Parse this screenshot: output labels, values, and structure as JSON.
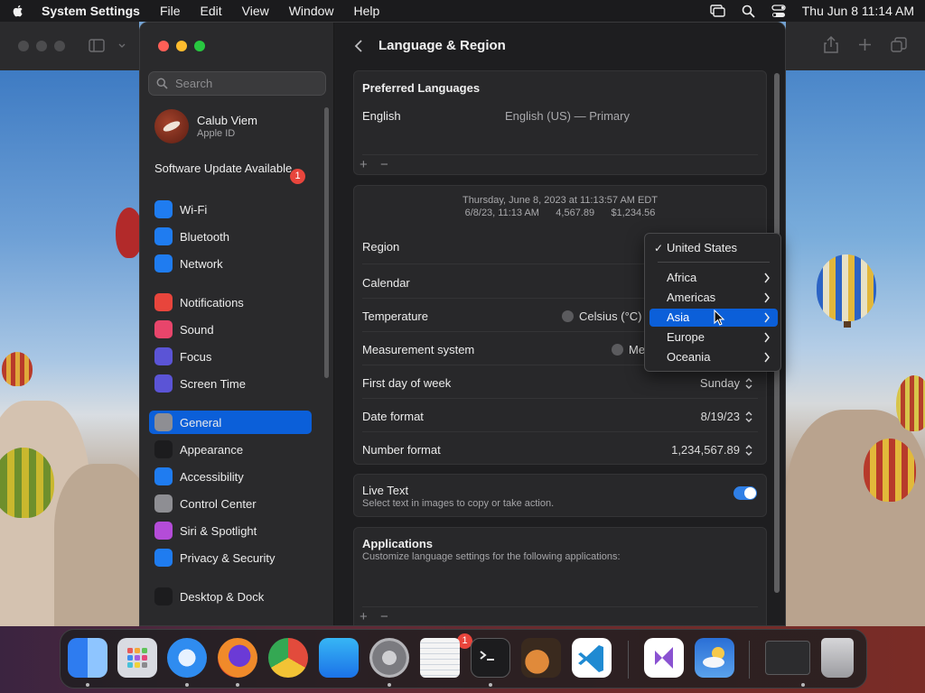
{
  "menubar": {
    "app": "System Settings",
    "items": [
      "File",
      "Edit",
      "View",
      "Window",
      "Help"
    ],
    "clock": "Thu Jun 8  11:14 AM"
  },
  "sidebar": {
    "search_placeholder": "Search",
    "profile": {
      "name": "Calub Viem",
      "sub": "Apple ID"
    },
    "update": {
      "label": "Software Update Available",
      "badge": "1"
    },
    "items": [
      {
        "label": "Wi-Fi",
        "icon": "wifi-icon",
        "color": "#1f7cf0"
      },
      {
        "label": "Bluetooth",
        "icon": "bluetooth-icon",
        "color": "#1f7cf0"
      },
      {
        "label": "Network",
        "icon": "globe-icon",
        "color": "#1f7cf0"
      },
      {
        "label": "Notifications",
        "icon": "bell-icon",
        "color": "#e8453c"
      },
      {
        "label": "Sound",
        "icon": "speaker-icon",
        "color": "#e8456b"
      },
      {
        "label": "Focus",
        "icon": "moon-icon",
        "color": "#5b54d6"
      },
      {
        "label": "Screen Time",
        "icon": "hourglass-icon",
        "color": "#5b54d6"
      },
      {
        "label": "General",
        "icon": "gear-icon",
        "color": "#8e8e93"
      },
      {
        "label": "Appearance",
        "icon": "appearance-icon",
        "color": "#1c1c1e"
      },
      {
        "label": "Accessibility",
        "icon": "accessibility-icon",
        "color": "#1f7cf0"
      },
      {
        "label": "Control Center",
        "icon": "control-center-icon",
        "color": "#8e8e93"
      },
      {
        "label": "Siri & Spotlight",
        "icon": "siri-icon",
        "color": "#b44cd8"
      },
      {
        "label": "Privacy & Security",
        "icon": "hand-icon",
        "color": "#1f7cf0"
      },
      {
        "label": "Desktop & Dock",
        "icon": "desktop-icon",
        "color": "#1c1c1e"
      }
    ]
  },
  "content": {
    "title": "Language & Region",
    "preferred": {
      "title": "Preferred Languages",
      "language": "English",
      "language_value": "English (US) — Primary",
      "add": "+",
      "remove": "−"
    },
    "format": {
      "preview_line1": "Thursday, June 8, 2023 at 11:13:57 AM EDT",
      "preview_line2": "6/8/23, 11:13 AM      4,567.89      $1,234.56",
      "region": "Region",
      "calendar": "Calendar",
      "temperature": "Temperature",
      "temperature_value": "Celsius (°C)",
      "measurement": "Measurement system",
      "measurement_value": "Me",
      "first_day": "First day of week",
      "first_day_value": "Sunday",
      "date_format": "Date format",
      "date_format_value": "8/19/23",
      "number_format": "Number format",
      "number_format_value": "1,234,567.89"
    },
    "live_text": {
      "title": "Live Text",
      "desc": "Select text in images to copy or take action.",
      "enabled": true
    },
    "applications": {
      "title": "Applications",
      "desc": "Customize language settings for the following applications:",
      "add": "+",
      "remove": "−"
    }
  },
  "region_menu": {
    "selected": "United States",
    "items": [
      "Africa",
      "Americas",
      "Asia",
      "Europe",
      "Oceania"
    ],
    "highlighted": "Asia"
  },
  "dock": {
    "settings_badge": "1",
    "apps": [
      "Finder",
      "Launchpad",
      "Safari",
      "Firefox",
      "Chrome",
      "App Store",
      "System Settings",
      "TextEdit",
      "Terminal",
      "GarageBand",
      "Visual Studio Code",
      "Visual Studio",
      "Weather",
      "Screen",
      "Trash"
    ]
  }
}
